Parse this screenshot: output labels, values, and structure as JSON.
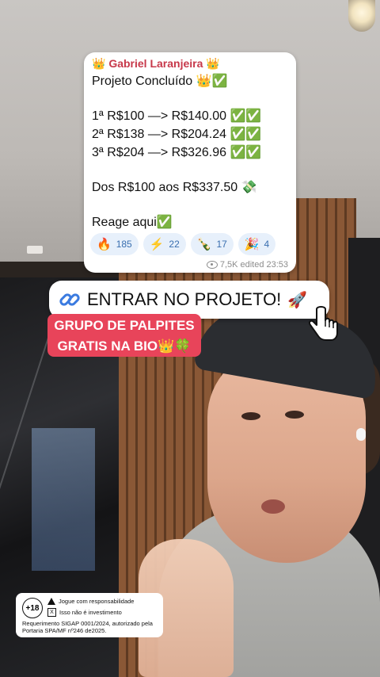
{
  "message": {
    "author": "👑 Gabriel Laranjeira 👑",
    "lines": [
      "Projeto Concluído 👑✅",
      "1ª R$100 —> R$140.00 ✅✅",
      "2ª R$138 —> R$204.24 ✅✅",
      "3ª R$204 —> R$326.96 ✅✅",
      "Dos R$100 aos R$337.50 💸",
      "Reage aqui✅"
    ],
    "reactions": [
      {
        "emoji": "🔥",
        "count": "185"
      },
      {
        "emoji": "⚡",
        "count": "22"
      },
      {
        "emoji": "🍾",
        "count": "17"
      },
      {
        "emoji": "🎉",
        "count": "4"
      }
    ],
    "views": "7,5K",
    "edited_label": "edited",
    "time": "23:53"
  },
  "cta": {
    "label": "ENTRAR NO PROJETO!",
    "rocket": "🚀"
  },
  "banner": {
    "line1": "GRUPO DE PALPITES",
    "line2": "GRATIS NA BIO👑🍀"
  },
  "disclaimer": {
    "age": "+18",
    "warning": "Jogue com responsabilidade",
    "not_investment": "Isso não é investimento",
    "x_mark": "X",
    "regulation": "Requerimento SIGAP 0001/2024, autorizado pela Portaria SPA/MF nº246 de2025."
  }
}
